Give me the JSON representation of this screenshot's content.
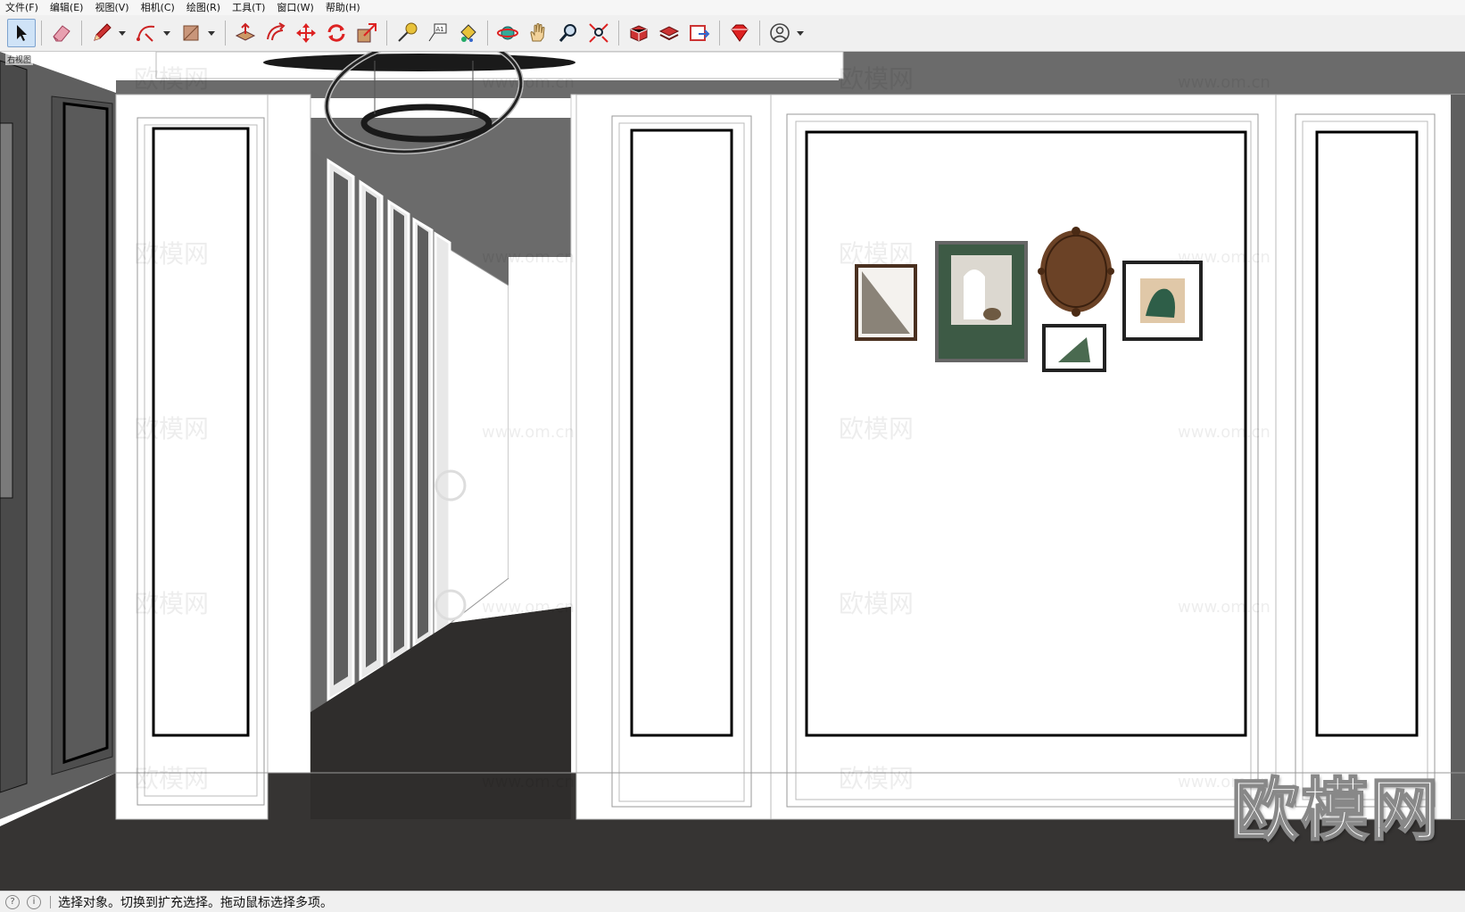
{
  "menu": {
    "items": [
      "文件(F)",
      "编辑(E)",
      "视图(V)",
      "相机(C)",
      "绘图(R)",
      "工具(T)",
      "窗口(W)",
      "帮助(H)"
    ]
  },
  "toolbar": {
    "tools": [
      {
        "name": "select-tool-icon",
        "active": true
      },
      {
        "name": "eraser-tool-icon"
      },
      {
        "name": "pencil-line-tool-icon",
        "dropdown": true
      },
      {
        "name": "arc-tool-icon",
        "dropdown": true
      },
      {
        "name": "rectangle-tool-icon",
        "dropdown": true
      },
      {
        "name": "push-pull-tool-icon"
      },
      {
        "name": "offset-tool-icon"
      },
      {
        "name": "move-tool-icon"
      },
      {
        "name": "rotate-tool-icon"
      },
      {
        "name": "scale-tool-icon"
      },
      {
        "name": "tape-measure-tool-icon"
      },
      {
        "name": "text-tool-icon"
      },
      {
        "name": "paint-bucket-tool-icon"
      },
      {
        "name": "orbit-tool-icon"
      },
      {
        "name": "pan-tool-icon"
      },
      {
        "name": "zoom-tool-icon"
      },
      {
        "name": "zoom-extents-tool-icon"
      },
      {
        "name": "3d-warehouse-icon"
      },
      {
        "name": "extension-warehouse-icon"
      },
      {
        "name": "send-to-layout-icon"
      },
      {
        "name": "extension-manager-icon"
      },
      {
        "name": "user-account-icon",
        "dropdown": true
      }
    ]
  },
  "viewport": {
    "view_label": "右视图",
    "watermark_text": "欧模网",
    "watermark_url": "www.om.cn",
    "logo_text": "欧模网"
  },
  "status": {
    "message": "选择对象。切换到扩充选择。拖动鼠标选择多项。"
  },
  "colors": {
    "floor": "#363433",
    "ceiling_shadow": "#6b6b6b",
    "left_wall": "#5f5f5f",
    "frame_green": "#3d5a45",
    "mirror_brown": "#6b4226"
  }
}
